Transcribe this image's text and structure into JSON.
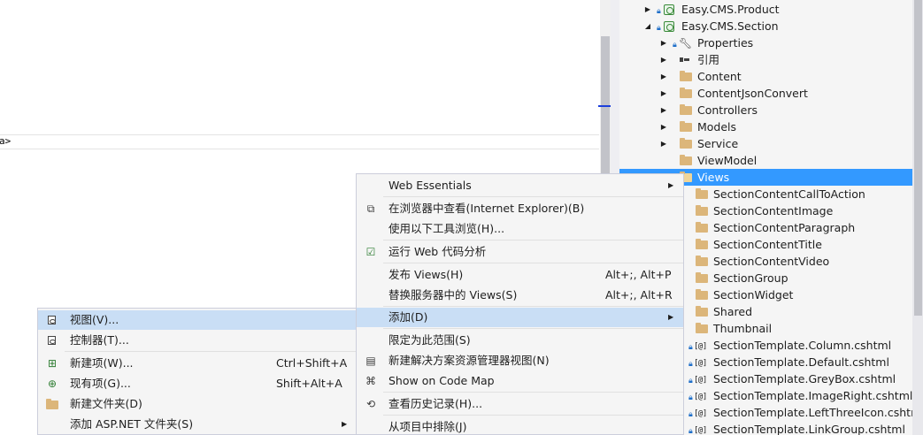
{
  "editor": {
    "line_fragment": "a>"
  },
  "tree": {
    "items": [
      {
        "label": "Easy.CMS.Product",
        "kind": "project"
      },
      {
        "label": "Easy.CMS.Section",
        "kind": "project"
      },
      {
        "label": "Properties",
        "kind": "properties"
      },
      {
        "label": "引用",
        "kind": "references"
      },
      {
        "label": "Content",
        "kind": "folder"
      },
      {
        "label": "ContentJsonConvert",
        "kind": "folder"
      },
      {
        "label": "Controllers",
        "kind": "folder"
      },
      {
        "label": "Models",
        "kind": "folder"
      },
      {
        "label": "Service",
        "kind": "folder"
      },
      {
        "label": "ViewModel",
        "kind": "folder"
      },
      {
        "label": "Views",
        "kind": "folder-open",
        "selected": true
      },
      {
        "label": "SectionContentCallToAction",
        "kind": "folder"
      },
      {
        "label": "SectionContentImage",
        "kind": "folder"
      },
      {
        "label": "SectionContentParagraph",
        "kind": "folder"
      },
      {
        "label": "SectionContentTitle",
        "kind": "folder"
      },
      {
        "label": "SectionContentVideo",
        "kind": "folder"
      },
      {
        "label": "SectionGroup",
        "kind": "folder"
      },
      {
        "label": "SectionWidget",
        "kind": "folder"
      },
      {
        "label": "Shared",
        "kind": "folder"
      },
      {
        "label": "Thumbnail",
        "kind": "folder"
      },
      {
        "label": "SectionTemplate.Column.cshtml",
        "kind": "file"
      },
      {
        "label": "SectionTemplate.Default.cshtml",
        "kind": "file"
      },
      {
        "label": "SectionTemplate.GreyBox.cshtml",
        "kind": "file"
      },
      {
        "label": "SectionTemplate.ImageRight.cshtml",
        "kind": "file"
      },
      {
        "label": "SectionTemplate.LeftThreeIcon.cshtml",
        "kind": "file"
      },
      {
        "label": "SectionTemplate.LinkGroup.cshtml",
        "kind": "file"
      }
    ]
  },
  "context_menu": {
    "items": [
      {
        "label": "Web Essentials",
        "icon": "none",
        "has_submenu": true
      },
      {
        "label": "在浏览器中查看(Internet Explorer)(B)",
        "icon": "browser-icon"
      },
      {
        "label": "使用以下工具浏览(H)...",
        "icon": "none"
      },
      {
        "label": "运行 Web 代码分析",
        "icon": "code-analysis-icon"
      },
      {
        "label": "发布 Views(H)",
        "icon": "none",
        "shortcut": "Alt+;, Alt+P"
      },
      {
        "label": "替换服务器中的 Views(S)",
        "icon": "none",
        "shortcut": "Alt+;, Alt+R"
      },
      {
        "label": "添加(D)",
        "icon": "none",
        "has_submenu": true,
        "highlighted": true
      },
      {
        "label": "限定为此范围(S)",
        "icon": "none"
      },
      {
        "label": "新建解决方案资源管理器视图(N)",
        "icon": "new-explorer-view-icon"
      },
      {
        "label": "Show on Code Map",
        "icon": "code-map-icon"
      },
      {
        "label": "查看历史记录(H)...",
        "icon": "history-icon"
      },
      {
        "label": "从项目中排除(J)",
        "icon": "none"
      }
    ]
  },
  "add_submenu": {
    "items": [
      {
        "label": "视图(V)...",
        "icon": "view-icon",
        "highlighted": true
      },
      {
        "label": "控制器(T)...",
        "icon": "controller-icon"
      },
      {
        "label": "新建项(W)...",
        "icon": "new-item-icon",
        "shortcut": "Ctrl+Shift+A"
      },
      {
        "label": "现有项(G)...",
        "icon": "existing-item-icon",
        "shortcut": "Shift+Alt+A"
      },
      {
        "label": "新建文件夹(D)",
        "icon": "new-folder-icon"
      },
      {
        "label": "添加 ASP.NET 文件夹(S)",
        "icon": "none",
        "has_submenu": true
      }
    ]
  },
  "colors": {
    "selection": "#3399ff",
    "menu_hover": "#c9def5",
    "folder": "#dcb67a"
  }
}
